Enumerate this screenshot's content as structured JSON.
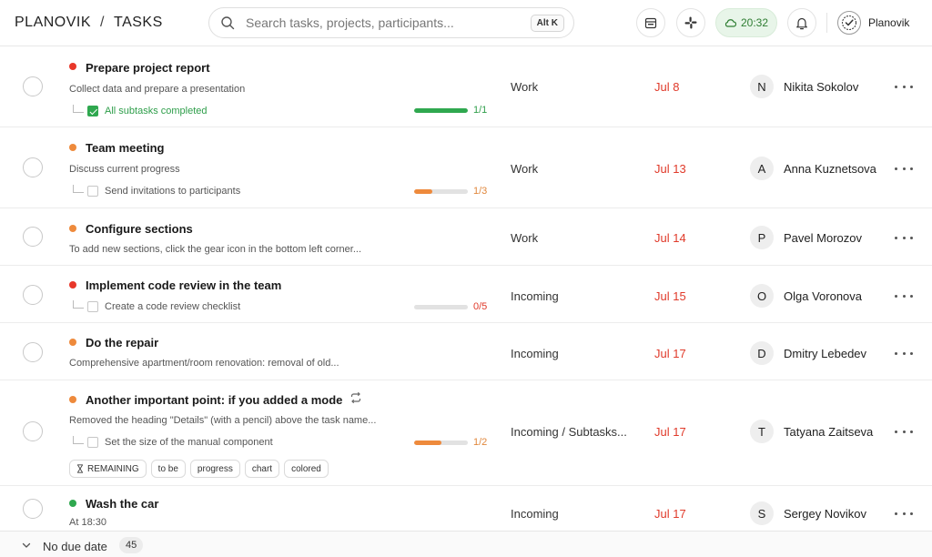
{
  "header": {
    "brand": "PLANOVIK",
    "separator": "/",
    "section": "TASKS",
    "search_placeholder": "Search tasks, projects, participants...",
    "shortcut": "Alt K",
    "sync_time": "20:32",
    "user_name": "Planovik"
  },
  "colors": {
    "red": "#e8372a",
    "orange": "#ee8a3c",
    "green": "#2fa84f",
    "due": "#e03a2a"
  },
  "tasks": [
    {
      "title": "Prepare project report",
      "priority": "red",
      "description": "Collect data and prepare a presentation",
      "subtask": "All subtasks completed",
      "subtask_done": true,
      "progress": 1.0,
      "ratio": "1/1",
      "project": "Work",
      "due": "Jul 8",
      "initial": "N",
      "assignee": "Nikita Sokolov"
    },
    {
      "title": "Team meeting",
      "priority": "orange",
      "description": "Discuss current progress",
      "subtask": "Send invitations to participants",
      "subtask_done": false,
      "progress": 0.333,
      "ratio": "1/3",
      "project": "Work",
      "due": "Jul 13",
      "initial": "A",
      "assignee": "Anna Kuznetsova"
    },
    {
      "title": "Configure sections",
      "priority": "orange",
      "description": "To add new sections, click the gear icon in the bottom left corner...",
      "project": "Work",
      "due": "Jul 14",
      "initial": "P",
      "assignee": "Pavel Morozov"
    },
    {
      "title": "Implement code review in the team",
      "priority": "red",
      "subtask": "Create a code review checklist",
      "subtask_done": false,
      "progress": 0,
      "ratio": "0/5",
      "project": "Incoming",
      "due": "Jul 15",
      "initial": "O",
      "assignee": "Olga Voronova"
    },
    {
      "title": "Do the repair",
      "priority": "orange",
      "description": "Comprehensive apartment/room renovation: removal of old...",
      "project": "Incoming",
      "due": "Jul 17",
      "initial": "D",
      "assignee": "Dmitry Lebedev"
    },
    {
      "title": "Another important point: if you added a mode",
      "priority": "orange",
      "recurring": true,
      "description": "Removed the heading \"Details\" (with a pencil) above the task name...",
      "subtask": "Set the size of the manual component",
      "subtask_done": false,
      "progress": 0.5,
      "ratio": "1/2",
      "tags": [
        "REMAINING",
        "to be",
        "progress",
        "chart",
        "colored"
      ],
      "project": "Incoming / Subtasks...",
      "due": "Jul 17",
      "initial": "T",
      "assignee": "Tatyana Zaitseva"
    },
    {
      "title": "Wash the car",
      "priority": "green",
      "description": "At 18:30",
      "project": "Incoming",
      "due": "Jul 17",
      "initial": "S",
      "assignee": "Sergey Novikov"
    }
  ],
  "group_footer": {
    "label": "No due date",
    "count": "45"
  }
}
